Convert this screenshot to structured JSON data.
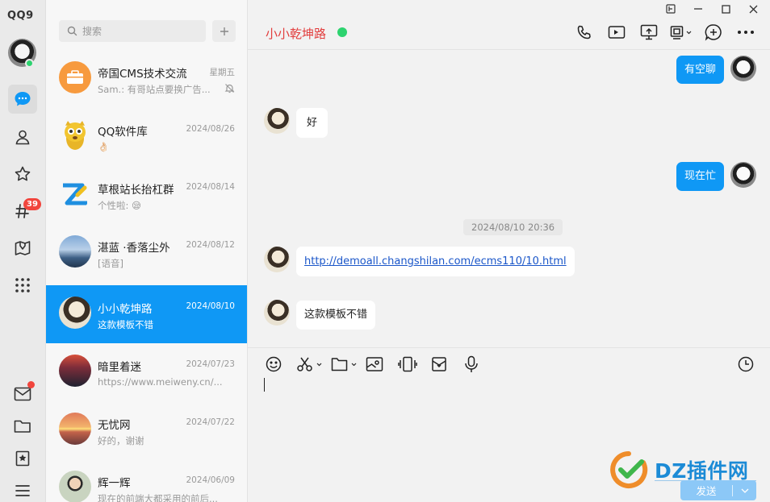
{
  "app": {
    "logo": "QQ9"
  },
  "rail": {
    "items": [
      {
        "name": "message-icon",
        "active": true
      },
      {
        "name": "contacts-icon"
      },
      {
        "name": "favorites-icon"
      },
      {
        "name": "channel-icon",
        "badge": "39"
      },
      {
        "name": "map-icon"
      },
      {
        "name": "apps-grid-icon"
      }
    ],
    "bottom": [
      "mail-icon",
      "folder-icon",
      "bookmark-icon",
      "menu-icon"
    ]
  },
  "search": {
    "placeholder": "搜索",
    "add_label": "+"
  },
  "conversations": [
    {
      "name": "帝国CMS技术交流",
      "date": "星期五",
      "msg": "Sam.: 有哥站点要换广告...",
      "muted": true
    },
    {
      "name": "QQ软件库",
      "date": "2024/08/26",
      "msg": "👌🏻"
    },
    {
      "name": "草根站长抬杠群",
      "date": "2024/08/14",
      "msg": "个性啦: 😪"
    },
    {
      "name": "湛蓝 ·香落尘外",
      "date": "2024/08/12",
      "msg": "[语音]"
    },
    {
      "name": "小小乾坤路",
      "date": "2024/08/10",
      "msg": "这款模板不错",
      "active": true
    },
    {
      "name": "暗里着迷",
      "date": "2024/07/23",
      "msg": "https://www.meiweny.cn/..."
    },
    {
      "name": "无忧网",
      "date": "2024/07/22",
      "msg": "好的，谢谢"
    },
    {
      "name": "辉一辉",
      "date": "2024/06/09",
      "msg": "现在的前端大都采用的前后..."
    }
  ],
  "chat": {
    "title": "小小乾坤路",
    "messages": [
      {
        "from": "me",
        "text": "有空聊"
      },
      {
        "from": "them",
        "text": "好"
      },
      {
        "from": "me",
        "text": "现在忙"
      },
      {
        "timestamp": "2024/08/10 20:36"
      },
      {
        "from": "them",
        "text": "http://demoall.changshilan.com/ecms110/10.html",
        "link": true
      },
      {
        "from": "them",
        "text": "这款模板不错"
      }
    ],
    "send_label": "发送"
  },
  "watermark": {
    "text": "DZ插件网"
  },
  "colors": {
    "accent": "#0f98f5",
    "online": "#2dd36f",
    "badge": "#f1453d",
    "title": "#e23c3c"
  }
}
